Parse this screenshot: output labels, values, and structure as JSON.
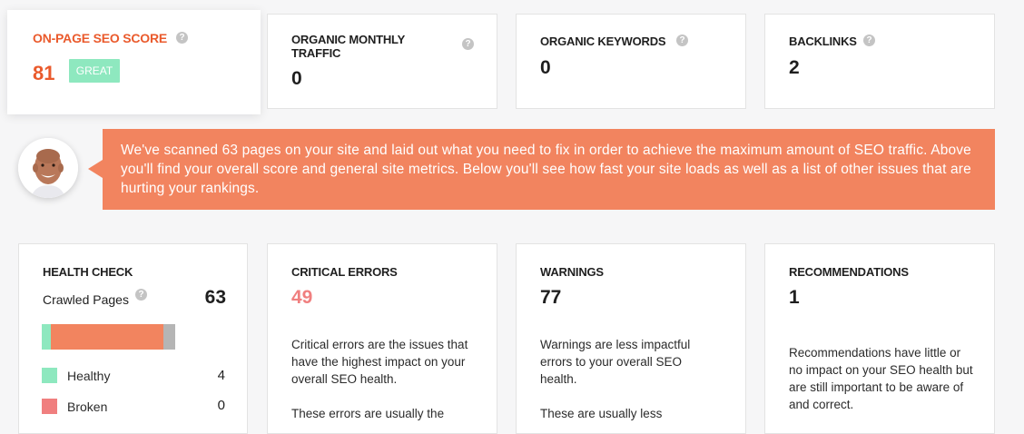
{
  "summary": {
    "seo_score": {
      "label": "ON-PAGE SEO SCORE",
      "value": "81",
      "badge": "GREAT"
    },
    "traffic": {
      "label": "ORGANIC MONTHLY TRAFFIC",
      "value": "0"
    },
    "keywords": {
      "label": "ORGANIC KEYWORDS",
      "value": "0"
    },
    "backlinks": {
      "label": "BACKLINKS",
      "value": "2"
    }
  },
  "banner": {
    "text": "We've scanned 63 pages on your site and laid out what you need to fix in order to achieve the maximum amount of SEO traffic. Above you'll find your overall score and general site metrics. Below you'll see how fast your site loads as well as a list of other issues that are hurting your rankings."
  },
  "help_glyph": "?",
  "health": {
    "label": "HEALTH CHECK",
    "crawled_label": "Crawled Pages",
    "crawled_value": "63",
    "bar": {
      "healthy_fraction": 0.0635,
      "broken_fraction": 0,
      "errors_fraction": 0.778,
      "other_fraction": 0.0794
    },
    "legend": [
      {
        "label": "Healthy",
        "value": "4",
        "color": "#8ee8bf"
      },
      {
        "label": "Broken",
        "value": "0",
        "color": "#f07f7f"
      }
    ]
  },
  "critical": {
    "label": "CRITICAL ERRORS",
    "value": "49",
    "desc1": "Critical errors are the issues that have the highest impact on your overall SEO health.",
    "desc2": "These errors are usually the"
  },
  "warnings": {
    "label": "WARNINGS",
    "value": "77",
    "desc1": "Warnings are less impactful errors to your overall SEO health.",
    "desc2": "These are usually less"
  },
  "recommendations": {
    "label": "RECOMMENDATIONS",
    "value": "1",
    "desc1": "Recommendations have little or no impact on your SEO health but are still important to be aware of and correct."
  },
  "colors": {
    "accent": "#ea5a2c",
    "banner": "#f2845f",
    "critical": "#f07f7f",
    "great": "#8ee8bf",
    "bar_main": "#f2845f",
    "bar_gray": "#b5b5b5"
  }
}
